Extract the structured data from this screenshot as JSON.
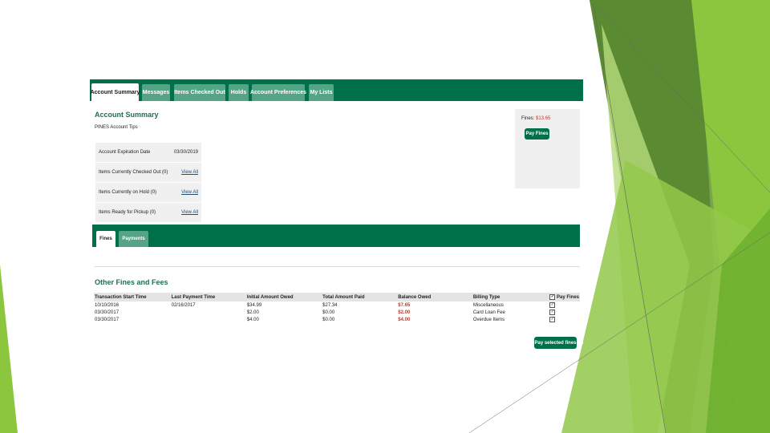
{
  "tabs": [
    {
      "label": "Account Summary",
      "active": true
    },
    {
      "label": "Messages",
      "active": false
    },
    {
      "label": "Items Checked Out",
      "active": false
    },
    {
      "label": "Holds",
      "active": false
    },
    {
      "label": "Account Preferences",
      "active": false
    },
    {
      "label": "My Lists",
      "active": false
    }
  ],
  "summary": {
    "title": "Account Summary",
    "tips": "PINES Account Tips",
    "rows": [
      {
        "label": "Account Expiration Date",
        "value": "03/30/2019",
        "is_link": false
      },
      {
        "label": "Items Currently Checked Out (0)",
        "value": "View All",
        "is_link": true
      },
      {
        "label": "Items Currently on Hold (0)",
        "value": "View All",
        "is_link": true
      },
      {
        "label": "Items Ready for Pickup (0)",
        "value": "View All",
        "is_link": true
      }
    ]
  },
  "fines_box": {
    "label": "Fines:",
    "amount": "$13.65",
    "button": "Pay Fines"
  },
  "subtabs": [
    {
      "label": "Fines",
      "active": true
    },
    {
      "label": "Payments",
      "active": false
    }
  ],
  "other": {
    "title": "Other Fines and Fees",
    "headers": [
      "Transaction Start Time",
      "Last Payment Time",
      "Initial Amount Owed",
      "Total Amount Paid",
      "Balance Owed",
      "Billing Type",
      "Pay Fines"
    ],
    "rows": [
      {
        "start": "10/10/2016",
        "last": "02/16/2017",
        "initial": "$34.99",
        "paid": "$27.34",
        "balance": "$7.65",
        "type": "Miscellaneous"
      },
      {
        "start": "03/30/2017",
        "last": "",
        "initial": "$2.00",
        "paid": "$0.00",
        "balance": "$2.00",
        "type": "Card Loan Fee"
      },
      {
        "start": "03/30/2017",
        "last": "",
        "initial": "$4.00",
        "paid": "$0.00",
        "balance": "$4.00",
        "type": "Overdue Items"
      }
    ],
    "pay_button": "Pay selected fines"
  },
  "colors": {
    "brand_green": "#00704a",
    "tab_inactive": "#56a486",
    "balance_red": "#c0392b"
  }
}
